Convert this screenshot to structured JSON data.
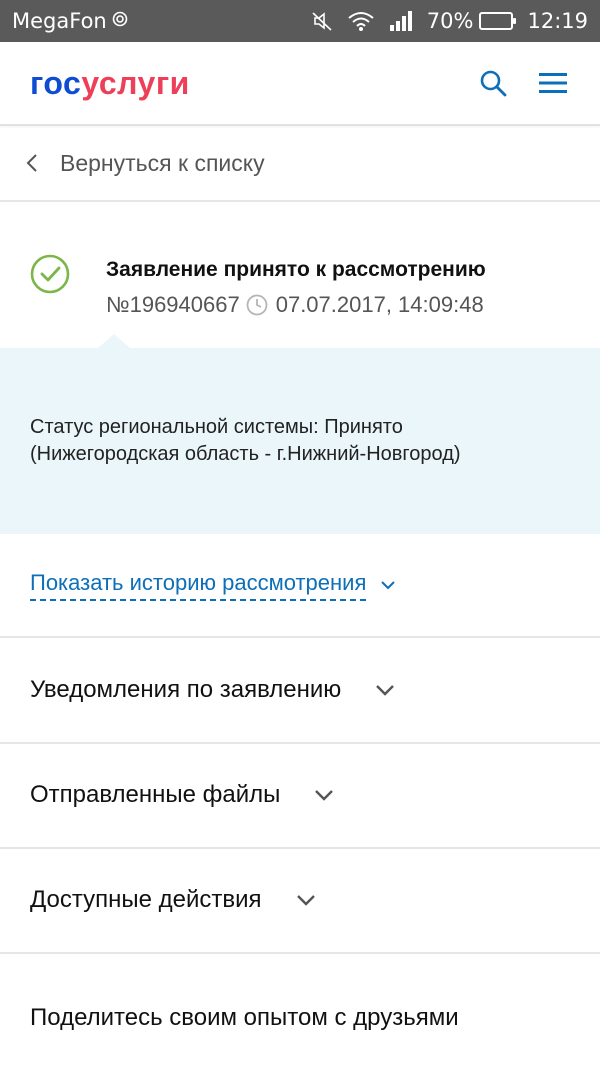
{
  "statusbar": {
    "carrier": "MegaFon",
    "battery_percent": "70%",
    "battery_level": 0.7,
    "time": "12:19",
    "icons": [
      "carrier-signal-icon",
      "mute-icon",
      "wifi-icon",
      "cell-signal-icon",
      "battery-icon"
    ]
  },
  "header": {
    "logo_part1": "гос",
    "logo_part2": "услуги",
    "logo_colors": {
      "part1": "#0d4cd3",
      "part2": "#ee3f58"
    },
    "icons": [
      "search-icon",
      "menu-icon"
    ],
    "accent": "#0d6fb8"
  },
  "back": {
    "label": "Вернуться к списку"
  },
  "application": {
    "status_title": "Заявление принято к рассмотрению",
    "number": "№196940667",
    "datetime": "07.07.2017, 14:09:48",
    "status_color": "#7ab648"
  },
  "region": {
    "line1": "Статус региональной системы: Принято",
    "line2": "(Нижегородская область - г.Нижний-Новгород)"
  },
  "history": {
    "label": "Показать историю рассмотрения"
  },
  "sections": [
    {
      "label": "Уведомления по заявлению"
    },
    {
      "label": "Отправленные файлы"
    },
    {
      "label": "Доступные действия"
    }
  ],
  "share": {
    "label": "Поделитесь своим опытом с друзьями"
  }
}
